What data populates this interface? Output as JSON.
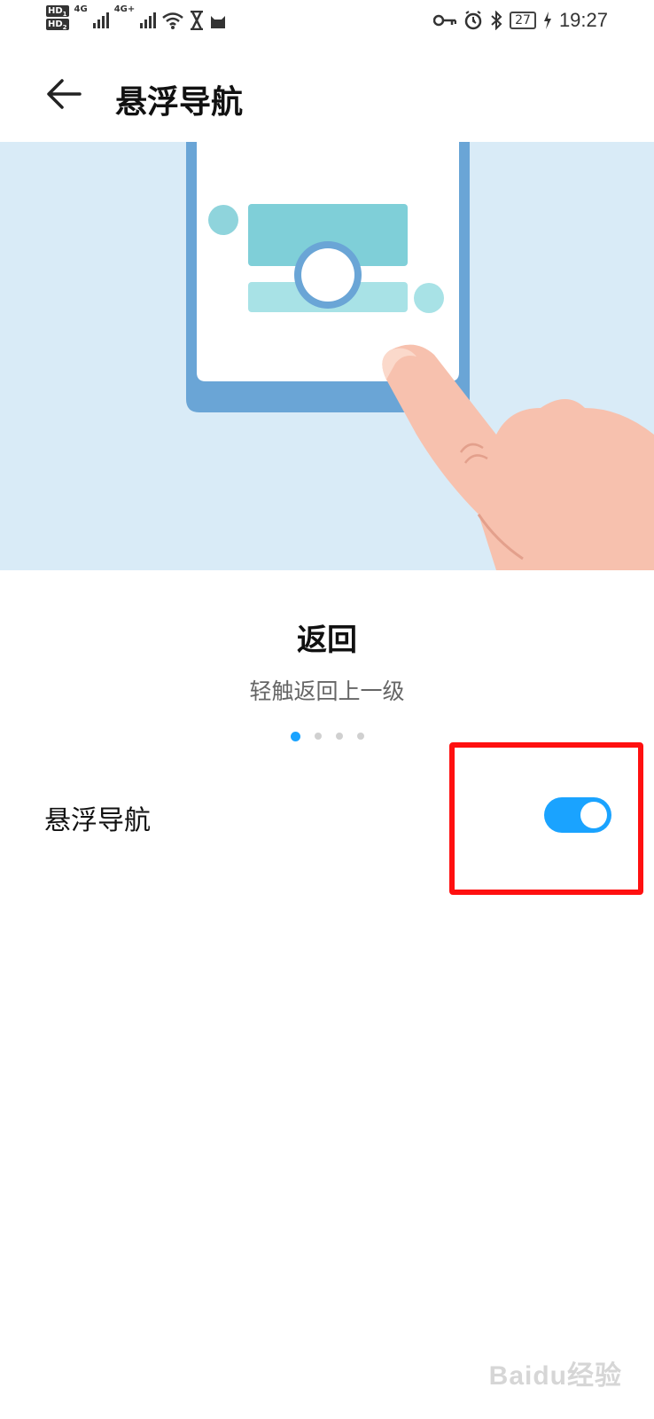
{
  "status_bar": {
    "hd1": "HD",
    "hd1_sub": "1",
    "hd2": "HD",
    "hd2_sub": "2",
    "net1": "4G",
    "net2": "4G+",
    "battery": "27",
    "time": "19:27",
    "icons": [
      "signal-icon",
      "wifi-icon",
      "hourglass-icon",
      "cat-icon",
      "key-icon",
      "alarm-icon",
      "bluetooth-icon",
      "battery-icon",
      "charging-icon"
    ]
  },
  "header": {
    "title": "悬浮导航",
    "back_icon": "back-arrow-icon"
  },
  "carousel": {
    "title": "返回",
    "subtitle": "轻触返回上一级",
    "page_count": 4,
    "active_index": 0
  },
  "setting": {
    "label": "悬浮导航",
    "enabled": true
  },
  "watermark": "Baidu经验",
  "colors": {
    "accent": "#1aa3ff",
    "illustration_bg": "#d9ebf7",
    "highlight": "#ff1010"
  }
}
